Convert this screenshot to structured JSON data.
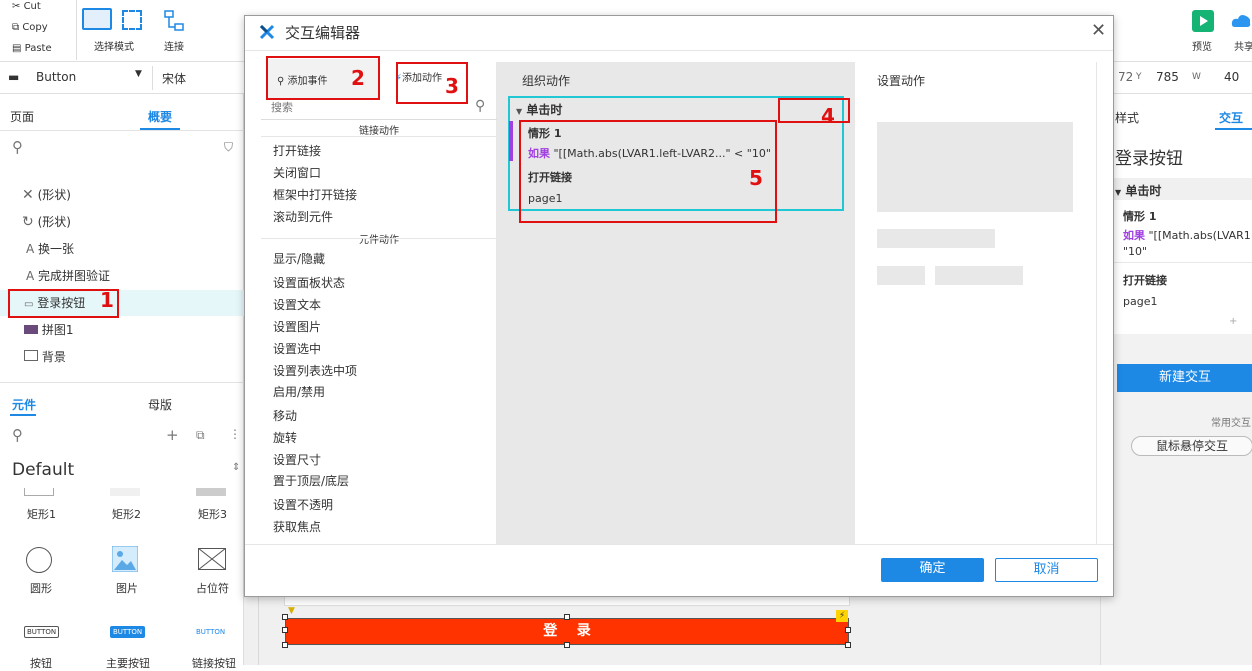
{
  "toolbar": {
    "cut": "Cut",
    "copy": "Copy",
    "paste": "Paste",
    "select_mode": "选择模式",
    "connect": "连接",
    "preview": "预览",
    "share": "共享"
  },
  "propbar": {
    "widget_type": "Button",
    "font": "宋体",
    "x_value": "72",
    "y_label": "Y",
    "y_value": "785",
    "w_label": "W",
    "w_value": "40"
  },
  "left_panel": {
    "tabs": [
      "页面",
      "概要"
    ],
    "outline_items": [
      {
        "label": "(形状)"
      },
      {
        "label": "(形状)"
      },
      {
        "label": "换一张"
      },
      {
        "label": "完成拼图验证"
      },
      {
        "label": "登录按钮"
      },
      {
        "label": "拼图1"
      },
      {
        "label": "背景"
      }
    ],
    "lib_tabs": [
      "元件",
      "母版"
    ],
    "library_name": "Default",
    "widgets_row1": [
      "矩形1",
      "矩形2",
      "矩形3"
    ],
    "widgets_row2": [
      "圆形",
      "图片",
      "占位符"
    ],
    "widgets_row3": [
      "按钮",
      "主要按钮",
      "链接按钮"
    ],
    "button_thumb": "BUTTON"
  },
  "canvas": {
    "login_button": "登    录"
  },
  "right_panel": {
    "tabs": [
      "样式",
      "交互"
    ],
    "widget_name": "登录按钮",
    "event": "单击时",
    "case_name": "情形 1",
    "if_kw": "如果",
    "condition_line1": "\"[[Math.abs(LVAR1",
    "condition_line2": "\"10\"",
    "action": "打开链接",
    "action_target": "page1",
    "plus": "+",
    "new_interaction": "新建交互",
    "common_label": "常用交互",
    "hover_button": "鼠标悬停交互"
  },
  "dialog": {
    "title": "交互编辑器",
    "add_event": "添加事件",
    "add_action": "添加动作",
    "search_placeholder": "搜索",
    "col_org": "组织动作",
    "col_set": "设置动作",
    "link_section": "链接动作",
    "link_actions": [
      "打开链接",
      "关闭窗口",
      "框架中打开链接",
      "滚动到元件"
    ],
    "widget_section": "元件动作",
    "widget_actions": [
      "显示/隐藏",
      "设置面板状态",
      "设置文本",
      "设置图片",
      "设置选中",
      "设置列表选中项",
      "启用/禁用",
      "移动",
      "旋转",
      "设置尺寸",
      "置于顶层/底层",
      "设置不透明",
      "获取焦点"
    ],
    "event_name": "单击时",
    "case_name": "情形 1",
    "if_kw": "如果",
    "condition": "\"[[Math.abs(LVAR1.left-LVAR2...\" < \"10\"",
    "action_name": "打开链接",
    "action_target": "page1",
    "ok": "确定",
    "cancel": "取消"
  },
  "annotations": [
    "1",
    "2",
    "3",
    "4",
    "5"
  ],
  "colors": {
    "accent": "#1e88e5",
    "annotation_red": "#e01010",
    "highlight_cyan": "#1fc8d4",
    "case_purple": "#a040e0",
    "login_red": "#ff3300"
  }
}
